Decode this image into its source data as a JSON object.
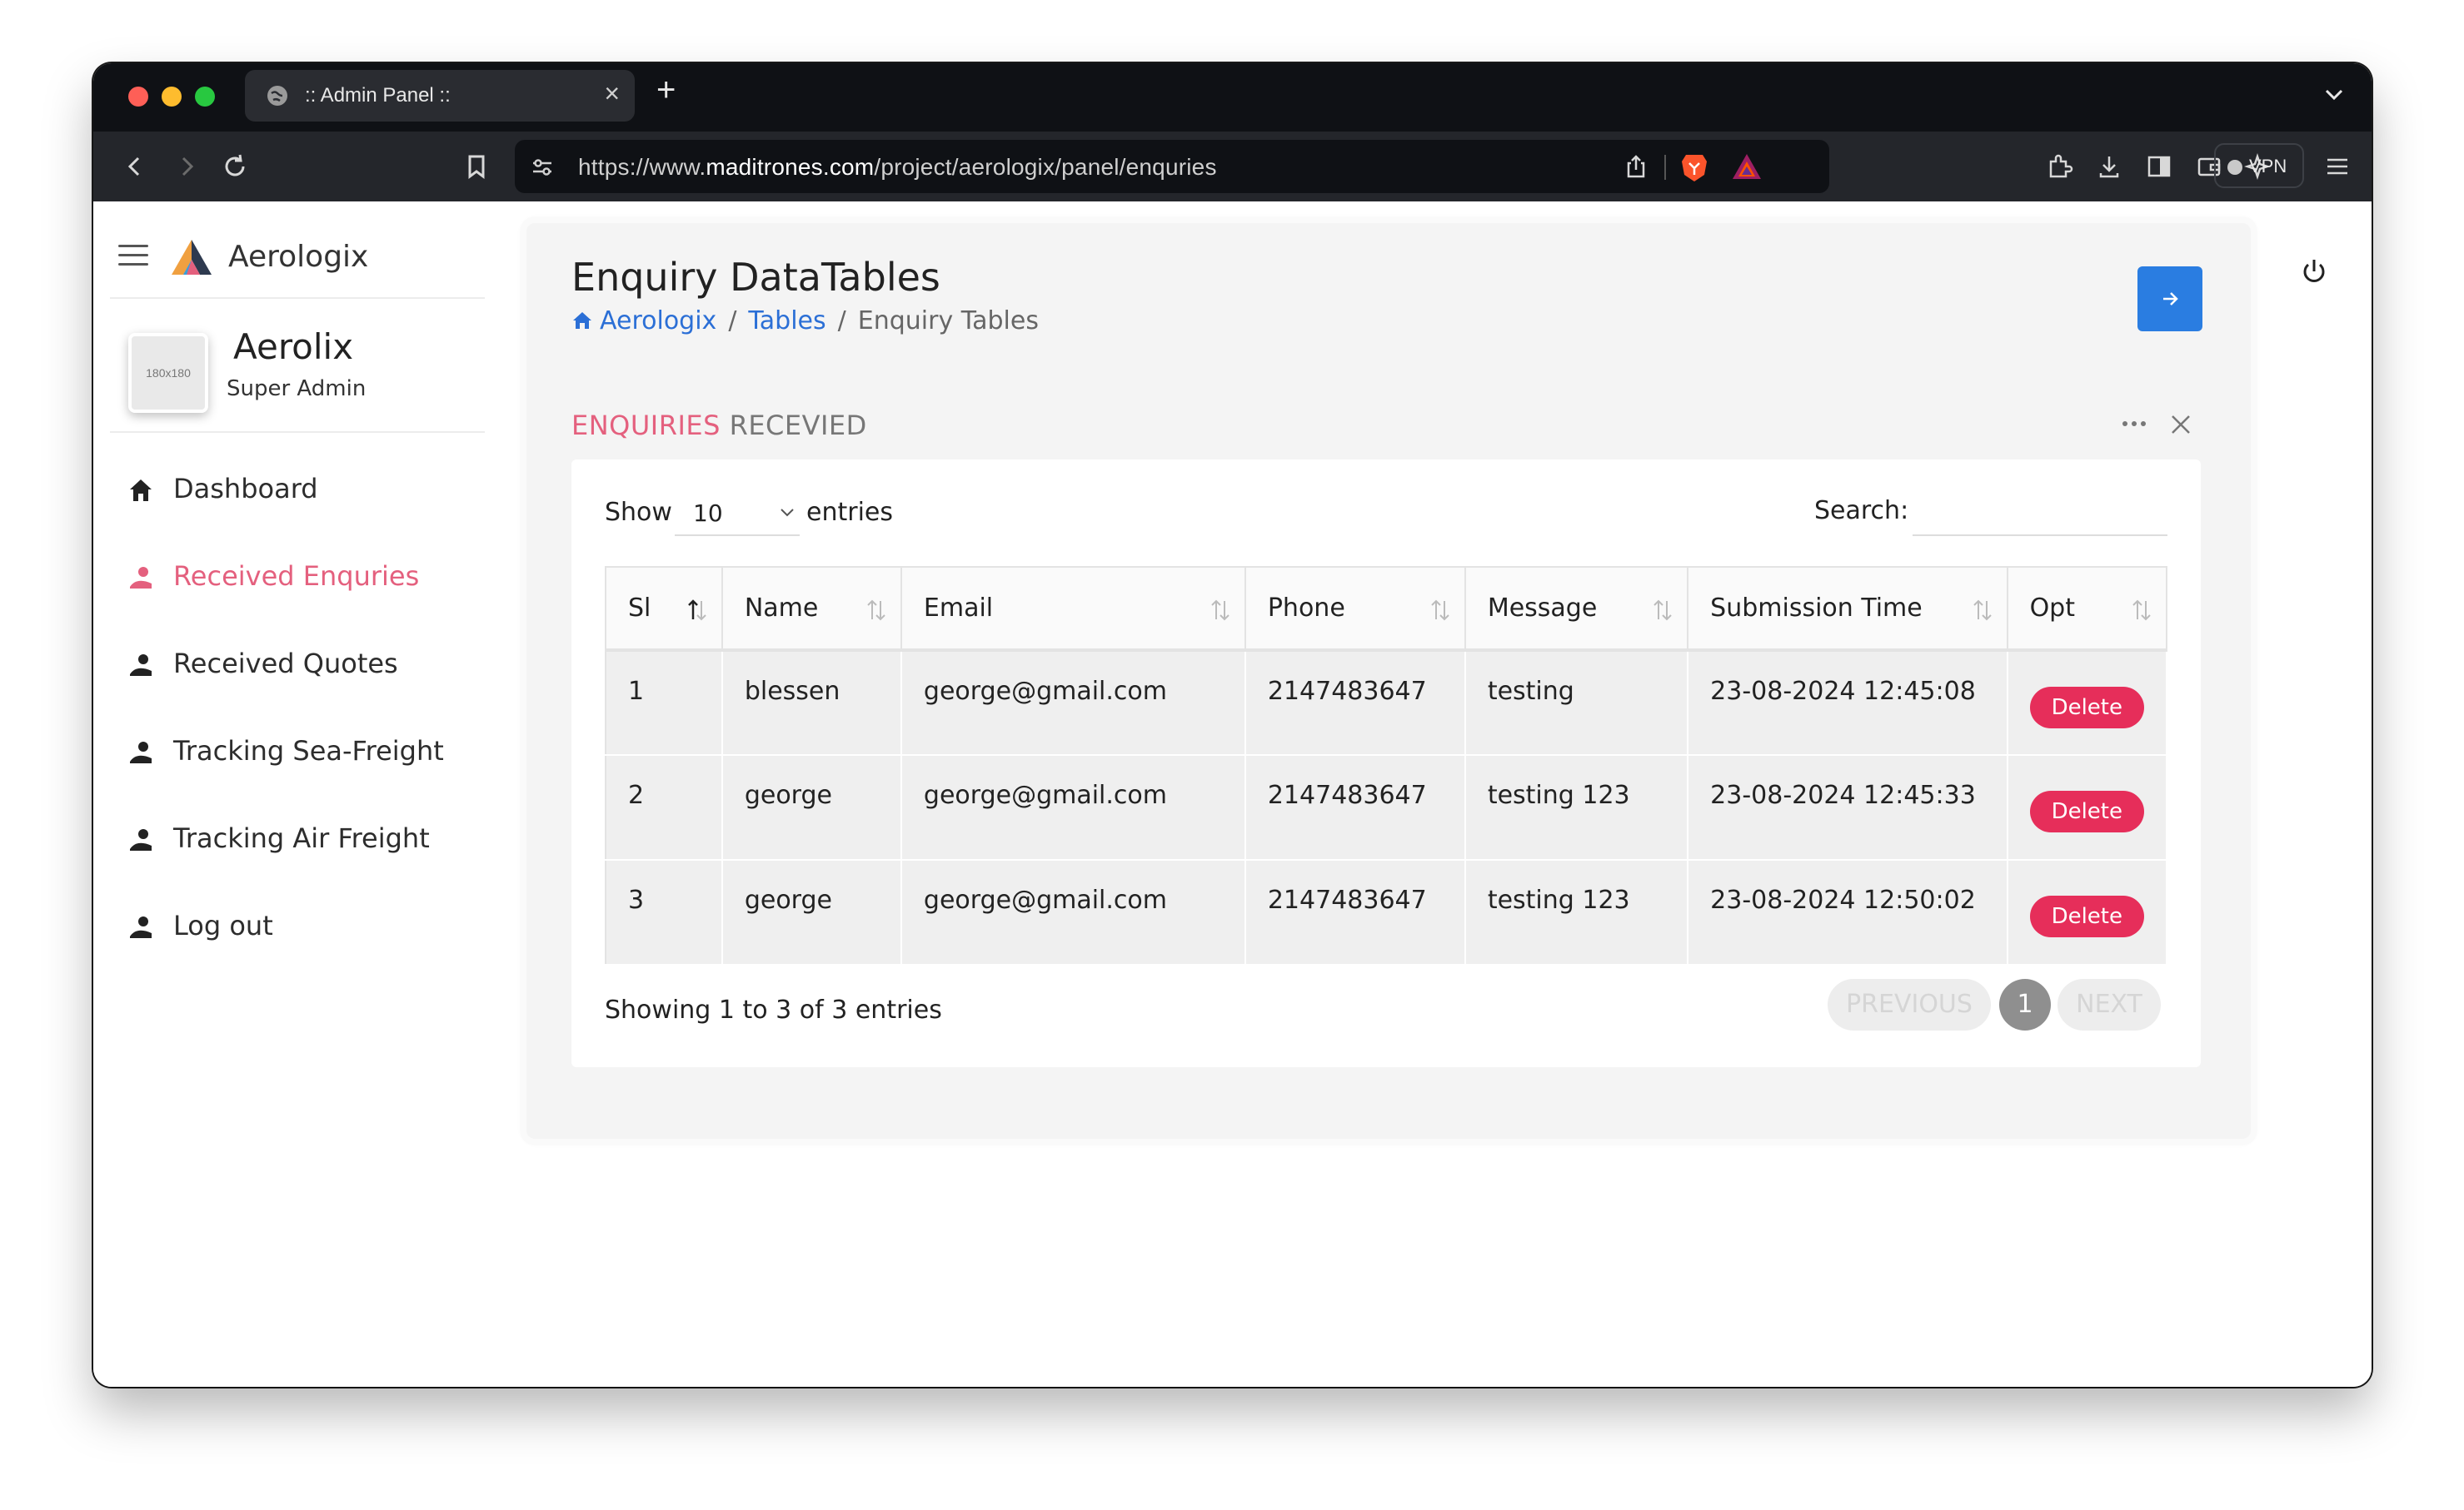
{
  "browser": {
    "tab_title": ":: Admin Panel ::",
    "tab_close": "×",
    "new_tab": "+",
    "url_prefix": "https://www.",
    "url_domain": "maditrones.com",
    "url_path": "/project/aerologix/panel/enquries",
    "vpn_label": "VPN",
    "icons": [
      "globe-icon",
      "back-icon",
      "forward-icon",
      "reload-icon",
      "bookmark-icon",
      "site-settings-icon",
      "share-icon",
      "brave-shield-icon",
      "brave-rewards-icon",
      "extensions-icon",
      "download-icon",
      "sidebar-icon",
      "wallet-icon",
      "leo-ai-icon",
      "menu-icon"
    ]
  },
  "sidebar": {
    "brand": "Aerologix",
    "avatar_placeholder": "180x180",
    "user_name": "Aerolix",
    "user_role": "Super Admin",
    "items": [
      {
        "label": "Dashboard",
        "icon": "home-icon",
        "active": false
      },
      {
        "label": "Received Enquries",
        "icon": "user-icon",
        "active": true
      },
      {
        "label": "Received Quotes",
        "icon": "user-icon",
        "active": false
      },
      {
        "label": "Tracking Sea-Freight",
        "icon": "user-icon",
        "active": false
      },
      {
        "label": "Tracking Air Freight",
        "icon": "user-icon",
        "active": false
      },
      {
        "label": "Log out",
        "icon": "user-icon",
        "active": false
      }
    ]
  },
  "header": {
    "title": "Enquiry DataTables",
    "breadcrumb": [
      "Aerologix",
      "Tables",
      "Enquiry Tables"
    ],
    "separator": "/"
  },
  "section": {
    "title_highlight": "ENQUIRIES",
    "title_rest": "RECEVIED"
  },
  "table": {
    "show_label": "Show",
    "show_value": "10",
    "entries_label": "entries",
    "search_label": "Search:",
    "search_value": "",
    "columns": [
      "Sl",
      "Name",
      "Email",
      "Phone",
      "Message",
      "Submission Time",
      "Opt"
    ],
    "rows": [
      {
        "sl": "1",
        "name": "blessen",
        "email": "george@gmail.com",
        "phone": "2147483647",
        "message": "testing",
        "time": "23-08-2024 12:45:08",
        "action": "Delete"
      },
      {
        "sl": "2",
        "name": "george",
        "email": "george@gmail.com",
        "phone": "2147483647",
        "message": "testing 123",
        "time": "23-08-2024 12:45:33",
        "action": "Delete"
      },
      {
        "sl": "3",
        "name": "george",
        "email": "george@gmail.com",
        "phone": "2147483647",
        "message": "testing 123",
        "time": "23-08-2024 12:50:02",
        "action": "Delete"
      }
    ],
    "info": "Showing 1 to 3 of 3 entries",
    "pagination": {
      "previous": "PREVIOUS",
      "current": "1",
      "next": "NEXT"
    }
  },
  "colors": {
    "accent_pink": "#e4607e",
    "delete_red": "#e62e5a",
    "link_blue": "#2b6fd6",
    "button_blue": "#2a7de1"
  }
}
